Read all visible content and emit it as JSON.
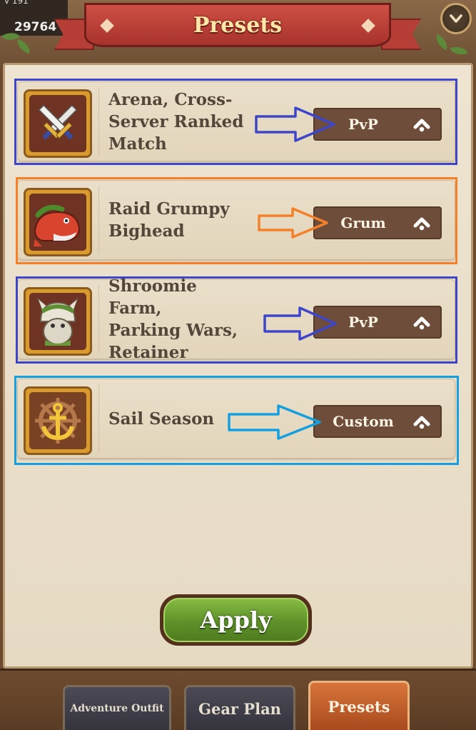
{
  "header": {
    "level_text": "v 191",
    "power_value": "29764",
    "title": "Presets",
    "fold_icon": "chevron-down-icon"
  },
  "presets": [
    {
      "label": "Arena, Cross-\nServer Ranked\nMatch",
      "mode": "PvP",
      "icon": "crossed-swords-icon"
    },
    {
      "label": "Raid Grumpy\nBighead",
      "mode": "Grum",
      "icon": "grumpy-whale-icon"
    },
    {
      "label": "Shroomie Farm,\nParking Wars,\nRetainer",
      "mode": "PvP",
      "icon": "shroomie-icon"
    },
    {
      "label": "Sail Season",
      "mode": "Custom",
      "icon": "anchor-wheel-icon"
    }
  ],
  "annotations": [
    {
      "row": 0,
      "color": "#3e45c9"
    },
    {
      "row": 1,
      "color": "#f4812a"
    },
    {
      "row": 2,
      "color": "#3e45c9"
    },
    {
      "row": 3,
      "color": "#169fdf"
    }
  ],
  "apply_label": "Apply",
  "tabs": [
    {
      "label": "Adventure Outfit",
      "active": false
    },
    {
      "label": "Gear Plan",
      "active": false
    },
    {
      "label": "Presets",
      "active": true
    }
  ],
  "colors": {
    "banner": "#b53f36",
    "title_text": "#ffe7a8",
    "mode_button": "#6e4e3b",
    "apply_button": "#5e9129",
    "active_tab": "#c4602c"
  }
}
